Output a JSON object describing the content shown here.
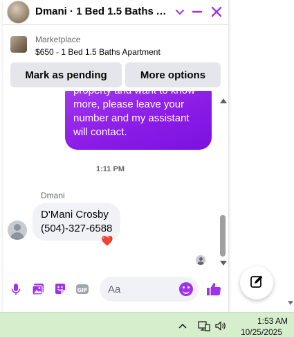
{
  "header": {
    "title": "Dmani · 1 Bed 1.5 Baths Ap...",
    "icons": [
      "chevron-down-icon",
      "minimize-icon",
      "close-icon"
    ],
    "accent": "#a033e8"
  },
  "listing": {
    "label": "Marketplace",
    "title": "$650 - 1 Bed 1.5 Baths Apartment"
  },
  "actions": {
    "pending_label": "Mark as pending",
    "more_label": "More options"
  },
  "messages": {
    "outgoing_lines": [
      "property and want to know",
      "more, please leave your",
      "number and my assistant",
      "will contact."
    ],
    "timestamp": "1:11 PM",
    "sender": "Dmani",
    "incoming_lines": [
      "D'Mani Crosby",
      "(504)-327-6588"
    ],
    "reaction": "❤️",
    "bubble_color": "#8a1be6"
  },
  "composer": {
    "placeholder": "Aa",
    "icons": [
      "microphone-icon",
      "photo-icon",
      "sticker-icon",
      "gif-icon",
      "emoji-icon",
      "thumbs-up-icon"
    ]
  },
  "taskbar": {
    "time": "1:53 AM",
    "date": "10/25/2025",
    "icons": [
      "chevron-up-icon",
      "network-icon",
      "volume-icon"
    ]
  }
}
